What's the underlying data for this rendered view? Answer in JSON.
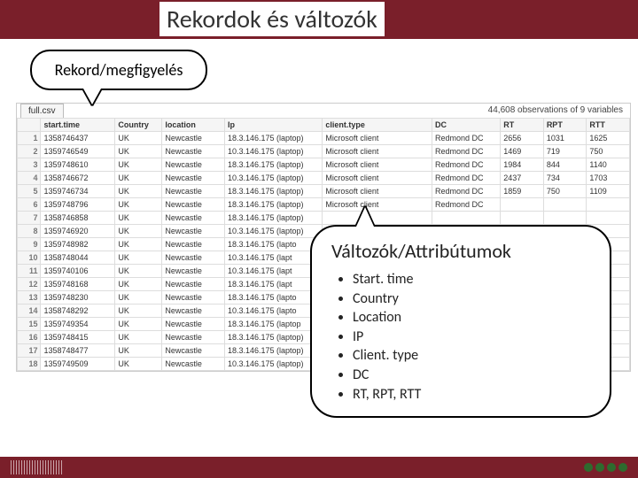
{
  "title": "Rekordok és változók",
  "callout1_label": "Rekord/megfigyelés",
  "table": {
    "tab": "full.csv",
    "info": "44,608 observations of 9 variables",
    "headers": [
      "start.time",
      "Country",
      "location",
      "Ip",
      "client.type",
      "DC",
      "RT",
      "RPT",
      "RTT"
    ],
    "rows": [
      {
        "n": "1",
        "t": "1358746437",
        "c": "UK",
        "l": "Newcastle",
        "i": "18.3.146.175 (laptop)",
        "ct": "Microsoft client",
        "dc": "Redmond DC",
        "rt": "2656",
        "rpt": "1031",
        "rtt": "1625"
      },
      {
        "n": "2",
        "t": "1359746549",
        "c": "UK",
        "l": "Newcastle",
        "i": "10.3.146.175 (laptop)",
        "ct": "Microsoft client",
        "dc": "Redmond DC",
        "rt": "1469",
        "rpt": "719",
        "rtt": "750"
      },
      {
        "n": "3",
        "t": "1359748610",
        "c": "UK",
        "l": "Newcastle",
        "i": "18.3.146.175 (laptop)",
        "ct": "Microsoft client",
        "dc": "Redmond DC",
        "rt": "1984",
        "rpt": "844",
        "rtt": "1140"
      },
      {
        "n": "4",
        "t": "1358746672",
        "c": "UK",
        "l": "Newcastle",
        "i": "10.3.146.175 (laptop)",
        "ct": "Microsoft client",
        "dc": "Redmond DC",
        "rt": "2437",
        "rpt": "734",
        "rtt": "1703"
      },
      {
        "n": "5",
        "t": "1359746734",
        "c": "UK",
        "l": "Newcastle",
        "i": "18.3.146.175 (laptop)",
        "ct": "Microsoft client",
        "dc": "Redmond DC",
        "rt": "1859",
        "rpt": "750",
        "rtt": "1109"
      },
      {
        "n": "6",
        "t": "1359748796",
        "c": "UK",
        "l": "Newcastle",
        "i": "18.3.146.175 (laptop)",
        "ct": "Microsoft client",
        "dc": "Redmond DC",
        "rt": "",
        "rpt": "",
        "rtt": ""
      },
      {
        "n": "7",
        "t": "1358746858",
        "c": "UK",
        "l": "Newcastle",
        "i": "18.3.146.175 (laptop)",
        "ct": "",
        "dc": "",
        "rt": "",
        "rpt": "",
        "rtt": ""
      },
      {
        "n": "8",
        "t": "1359746920",
        "c": "UK",
        "l": "Newcastle",
        "i": "10.3.146.175 (laptop)",
        "ct": "",
        "dc": "",
        "rt": "",
        "rpt": "",
        "rtt": ""
      },
      {
        "n": "9",
        "t": "1359748982",
        "c": "UK",
        "l": "Newcastle",
        "i": "18.3.146.175 (lapto",
        "ct": "",
        "dc": "",
        "rt": "",
        "rpt": "",
        "rtt": ""
      },
      {
        "n": "10",
        "t": "1358748044",
        "c": "UK",
        "l": "Newcastle",
        "i": "10.3.146.175 (lapt",
        "ct": "",
        "dc": "",
        "rt": "",
        "rpt": "",
        "rtt": ""
      },
      {
        "n": "11",
        "t": "1359740106",
        "c": "UK",
        "l": "Newcastle",
        "i": "10.3.146.175 (lapt",
        "ct": "",
        "dc": "",
        "rt": "",
        "rpt": "",
        "rtt": ""
      },
      {
        "n": "12",
        "t": "1359748168",
        "c": "UK",
        "l": "Newcastle",
        "i": "18.3.146.175 (lapt",
        "ct": "",
        "dc": "",
        "rt": "",
        "rpt": "",
        "rtt": ""
      },
      {
        "n": "13",
        "t": "1359748230",
        "c": "UK",
        "l": "Newcastle",
        "i": "18.3.146.175 (lapto",
        "ct": "",
        "dc": "",
        "rt": "",
        "rpt": "",
        "rtt": ""
      },
      {
        "n": "14",
        "t": "1358748292",
        "c": "UK",
        "l": "Newcastle",
        "i": "10.3.146.175 (lapto",
        "ct": "",
        "dc": "",
        "rt": "",
        "rpt": "",
        "rtt": ""
      },
      {
        "n": "15",
        "t": "1359749354",
        "c": "UK",
        "l": "Newcastle",
        "i": "18.3.146.175 (laptop",
        "ct": "",
        "dc": "",
        "rt": "",
        "rpt": "",
        "rtt": ""
      },
      {
        "n": "16",
        "t": "1359748415",
        "c": "UK",
        "l": "Newcastle",
        "i": "18.3.146.175 (laptop)",
        "ct": "",
        "dc": "",
        "rt": "",
        "rpt": "",
        "rtt": ""
      },
      {
        "n": "17",
        "t": "1358748477",
        "c": "UK",
        "l": "Newcastle",
        "i": "18.3.146.175 (laptop)",
        "ct": "",
        "dc": "",
        "rt": "",
        "rpt": "",
        "rtt": ""
      },
      {
        "n": "18",
        "t": "1359749509",
        "c": "UK",
        "l": "Newcastle",
        "i": "10.3.146.175 (laptop)",
        "ct": "",
        "dc": "",
        "rt": "",
        "rpt": "",
        "rtt": ""
      }
    ]
  },
  "callout2": {
    "title": "Változók/Attribútumok",
    "items": [
      "Start. time",
      "Country",
      "Location",
      "IP",
      "Client. type",
      "DC",
      "RT, RPT, RTT"
    ]
  }
}
